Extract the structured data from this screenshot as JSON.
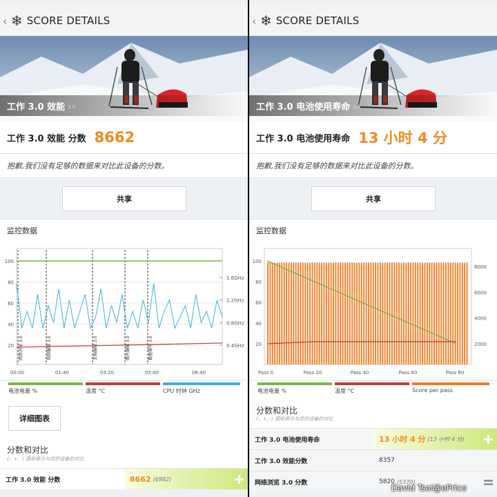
{
  "left": {
    "topbar_title": "SCORE DETAILS",
    "hero_label": "工作 3.0 效能",
    "hero_version": "3.0",
    "score_label": "工作 3.0 效能 分数",
    "score_value": "8662",
    "note": "抱歉,我们没有足够的数据来对比此设备的分数。",
    "share_label": "共享",
    "monitor_title": "监控数据",
    "legend": [
      "电池电量 %",
      "温度 °C",
      "CPU 时钟 GHz"
    ],
    "detail_button": "详细图表",
    "compare_title": "分数和对比",
    "compare_sub": "(-, +, -) 图标表示与您的设备的对比",
    "rows": [
      {
        "label": "工作 3.0 效能 分数",
        "value": "8662",
        "sub": "(6982)"
      }
    ]
  },
  "right": {
    "topbar_title": "SCORE DETAILS",
    "hero_label": "工作 3.0 电池使用寿命",
    "hero_version": "3.0",
    "score_label": "工作 3.0 电池使用寿命",
    "score_value": "13 小时 4 分",
    "note": "抱歉,我们没有足够的数据来对比此设备的分数。",
    "share_label": "共享",
    "monitor_title": "监控数据",
    "legend": [
      "电池电量 %",
      "温度 °C",
      "Score per pass"
    ],
    "compare_title": "分数和对比",
    "compare_sub": "(-, +, -) 图标表示与您的设备的对比",
    "rows": [
      {
        "label": "工作 3.0 电池使用寿命",
        "value": "13 小时 4 分",
        "sub": "(13 小时 4 分)"
      },
      {
        "label": "工作 3.0 效能分数",
        "value": "8357",
        "sub": ""
      },
      {
        "label": "网络浏览 3.0 分数",
        "value": "5820",
        "sub": "(5370)"
      }
    ]
  },
  "watermark": "David Tsai@ePrice",
  "colors": {
    "accent": "#f28a1e",
    "battery": "#7ab648",
    "temp": "#c0393b",
    "cpu": "#3fb0e0",
    "score": "#f07c22"
  },
  "chart_data": [
    {
      "type": "line",
      "x_ticks": [
        "00:00",
        "01:40",
        "03:20",
        "05:00",
        "06:40"
      ],
      "y_ticks_left": [
        100,
        80,
        60,
        40,
        20
      ],
      "y_ticks_right": [
        "1.6GHz",
        "1.2GHz",
        "0.8GHz",
        "0.4GHz"
      ],
      "annotations": [
        "网页浏览 3.0",
        "视频编辑 3.0",
        "文档编辑 3.0",
        "照片编辑 3.0",
        "数据操作 3.0"
      ],
      "series": [
        {
          "name": "电池电量 %",
          "values": [
            100,
            100,
            100,
            100,
            100
          ]
        },
        {
          "name": "温度 °C",
          "values": [
            18,
            19,
            20,
            21,
            22
          ]
        },
        {
          "name": "CPU 时钟 GHz",
          "values": [
            1.5,
            0.7,
            1.0,
            0.7,
            1.3,
            0.7,
            1.1,
            0.8,
            1.4,
            0.7,
            1.2,
            0.7,
            1.0,
            1.3,
            0.7,
            0.9,
            1.4,
            0.7,
            1.1,
            0.8,
            1.3,
            0.7,
            1.0,
            0.7,
            1.2,
            0.8,
            1.5,
            0.7,
            1.0,
            1.2,
            0.7,
            0.9,
            1.1,
            0.7,
            1.3,
            0.8,
            1.0,
            0.7,
            1.2,
            0.9
          ]
        }
      ]
    },
    {
      "type": "bar",
      "x_ticks": [
        "Pass 0",
        "Pass 20",
        "Pass 40",
        "Pass 60",
        "Pass 80"
      ],
      "y_ticks_left": [
        100,
        80,
        60,
        40,
        20
      ],
      "y_ticks_right": [
        8000,
        6000,
        4000,
        2000
      ],
      "series": [
        {
          "name": "电池电量 %",
          "values": [
            100,
            20
          ]
        },
        {
          "name": "温度 °C",
          "values": [
            20,
            22,
            22,
            22,
            22
          ]
        },
        {
          "name": "Score per pass",
          "values": [
            8300
          ]
        }
      ]
    }
  ]
}
